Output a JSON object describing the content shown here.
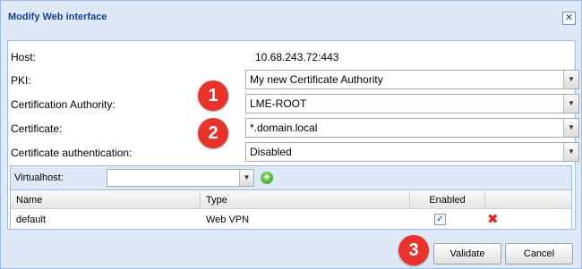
{
  "dialog": {
    "title": "Modify Web interface",
    "close_glyph": "✕"
  },
  "form": {
    "host_label": "Host:",
    "host_value": "10.68.243.72:443",
    "pki_label": "PKI:",
    "pki_value": "My new Certificate Authority",
    "ca_label": "Certification Authority:",
    "ca_value": "LME-ROOT",
    "cert_label": "Certificate:",
    "cert_value": "*.domain.local",
    "cert_auth_label": "Certificate authentication:",
    "cert_auth_value": "Disabled"
  },
  "badges": {
    "one": "1",
    "two": "2",
    "three": "3",
    "color": "#e8322c"
  },
  "grid": {
    "toolbar_label": "Virtualhost:",
    "virtualhost_value": "",
    "add_glyph": "+",
    "columns": [
      "Name",
      "Type",
      "Enabled",
      ""
    ],
    "rows": [
      {
        "name": "default",
        "type": "Web VPN",
        "enabled": true,
        "enabled_glyph": "✓",
        "delete_glyph": "✖"
      }
    ]
  },
  "buttons": {
    "validate": "Validate",
    "cancel": "Cancel"
  },
  "icons": {
    "dropdown": "▼",
    "add": "add-circle-icon",
    "delete": "red-x-icon"
  }
}
